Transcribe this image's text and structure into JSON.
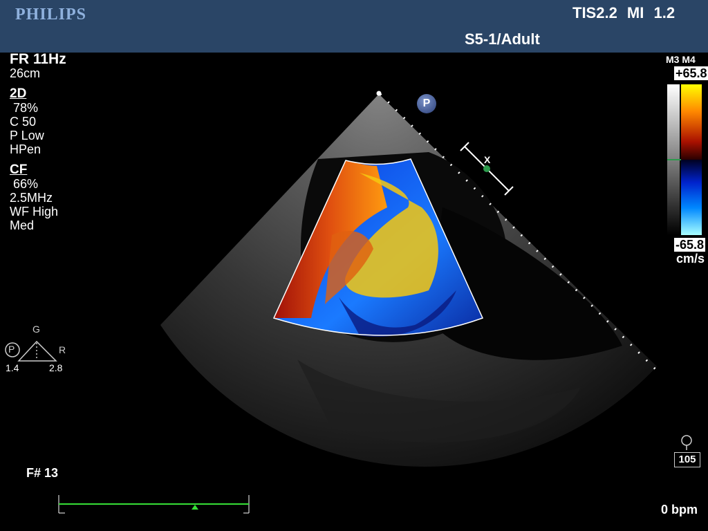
{
  "header": {
    "brand": "PHILIPS",
    "tis_mi": "TIS2.2  MI 1.2",
    "probe": "S5-1/Adult"
  },
  "params": {
    "frame_rate": "FR 11Hz",
    "depth": "26cm",
    "mode_2d": {
      "label": "2D",
      "gain": " 78%",
      "compression": "C 50",
      "power": "P Low",
      "harmonic": "HPen"
    },
    "mode_cf": {
      "label": "CF",
      "gain": " 66%",
      "frequency": "2.5MHz",
      "wall_filter": "WF High",
      "smoothing": "Med"
    }
  },
  "color_bar": {
    "header": "M3 M4",
    "max_value": "+65.8",
    "min_value": "-65.8",
    "unit": "cm/s"
  },
  "orientation": {
    "g_label": "G",
    "r_label": "R",
    "p_label": "P",
    "left_value": "1.4",
    "right_value": "2.8"
  },
  "focus_marker_label": "X",
  "probe_marker_label": "P",
  "frame_number": "F# 13",
  "heart_rate": "0 bpm",
  "heart_icon_value": "105",
  "icons": [
    "probe-position-marker-icon",
    "heart-icon",
    "ecg-trigger-icon",
    "focus-marker-icon"
  ]
}
